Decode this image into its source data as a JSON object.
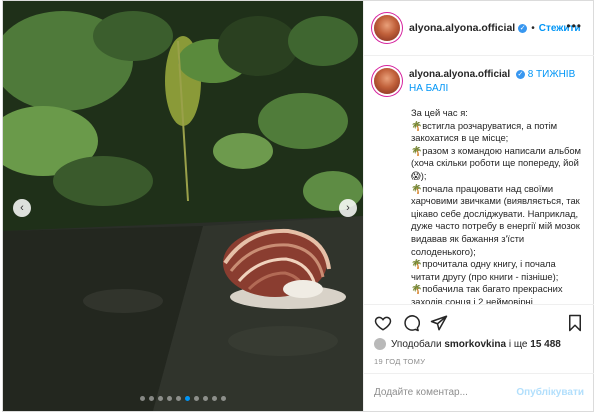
{
  "post": {
    "username": "alyona.alyona.official",
    "follow_label": "Стежити",
    "separator": "•",
    "more_label": "•••",
    "caption_title": "8 ТИЖНІВ НА БАЛІ",
    "caption_intro": "За цей час я:",
    "caption_items": [
      "встигла розчаруватися, а потім закохатися в це місце;",
      "разом з командою написали альбом (хоча скільки роботи ще попереду, йой😱);",
      "почала працювати над своїми харчовими звичками (виявляється, так цікаво себе досліджувати. Наприклад, дуже часто потребу в енергії мій мозок видавав як бажання з'їсти солоденького);",
      "прочитала одну книгу, і почала читати другу (про книги - пізніше);",
      "побачила так багато прекрасних заходів сонця і 2 неймовірні"
    ],
    "item_icon": "🌴",
    "likes_prefix": "Уподобали",
    "likes_user": "smorkovkina",
    "likes_middle": "і ще",
    "likes_count": "15 488",
    "time_ago": "19 ГОД ТОМУ",
    "comment_placeholder": "Додайте коментар...",
    "publish_label": "Опублікувати"
  },
  "carousel": {
    "slides": 10,
    "active_index": 5,
    "prev_icon": "‹",
    "next_icon": "›"
  },
  "icons": {
    "like": "heart-icon",
    "comment": "comment-icon",
    "share": "share-icon",
    "save": "bookmark-icon"
  }
}
